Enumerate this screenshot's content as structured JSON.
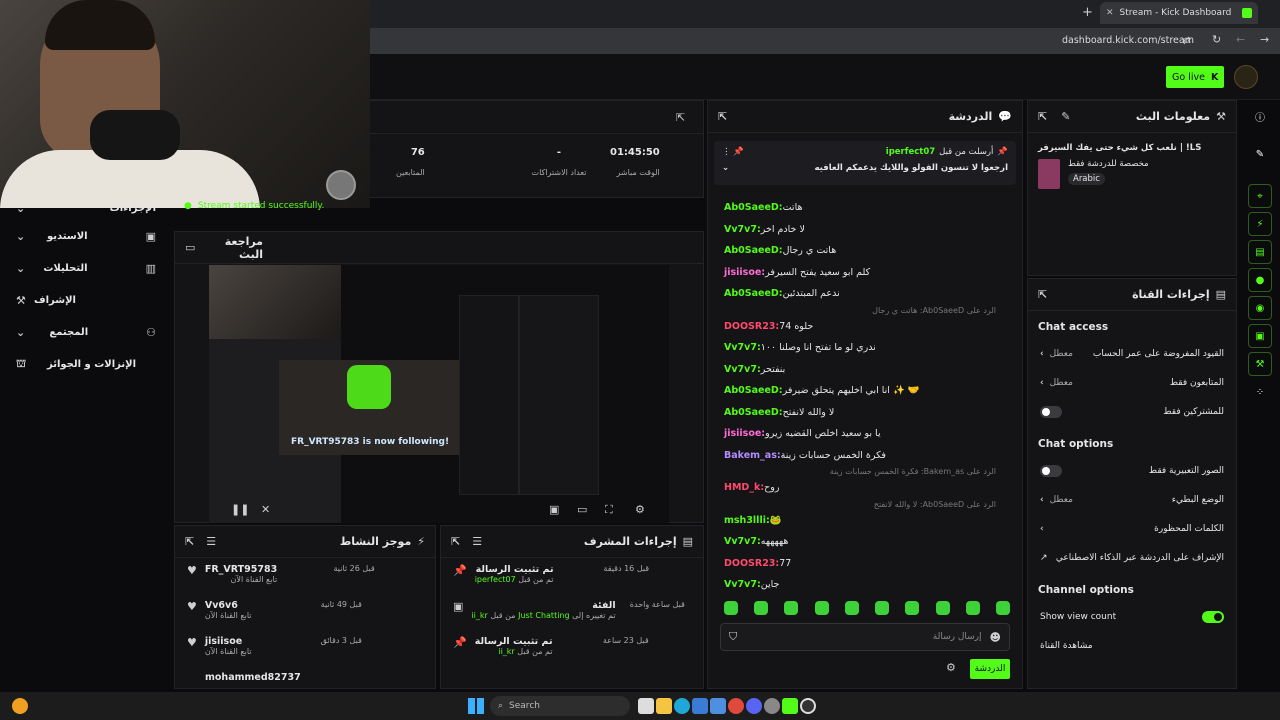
{
  "browser": {
    "tab_title": "Stream - Kick Dashboard",
    "new_tab": "+",
    "url": "dashboard.kick.com/stream"
  },
  "header": {
    "go_live_label": "Go live"
  },
  "stats": [
    {
      "value": "76",
      "label": "المتابعين"
    },
    {
      "value": "-",
      "label": "تعداد الاشتراكات"
    },
    {
      "value": "01:45:50",
      "label": "الوقت مباشر"
    }
  ],
  "toast": "Stream started successfully.",
  "preview": {
    "title": "مراجعة البث",
    "follow_text": "FR_VRT95783 is now following!"
  },
  "sidebar": {
    "items": [
      {
        "label": "الإجراءات"
      },
      {
        "label": "الاستديو"
      },
      {
        "label": "التحليلات"
      },
      {
        "label": "الإشراف"
      },
      {
        "label": "المجتمع"
      },
      {
        "label": "الإنزالات و الجوائز"
      }
    ]
  },
  "activity": {
    "title": "موجز النشاط",
    "items": [
      {
        "user": "FR_VRT95783",
        "sub": "تابع القناة الآن",
        "time": "قبل 26 ثانية"
      },
      {
        "user": "Vv6v6",
        "sub": "تابع القناة الآن",
        "time": "قبل 49 ثانية"
      },
      {
        "user": "jisiisoe",
        "sub": "تابع القناة الآن",
        "time": "قبل 3 دقائق"
      },
      {
        "user": "mohammed82737",
        "sub": "",
        "time": ""
      }
    ]
  },
  "modactions": {
    "title": "إجراءات المشرف",
    "items": [
      {
        "title": "تم تثبيت الرسالة",
        "sub_prefix": "تم من قبل",
        "sub_user": "iperfect07",
        "time": "قبل 16 دقيقة"
      },
      {
        "title": "الفئة",
        "sub_prefix": "تم تغييره إلى",
        "sub_user": "Just Chatting",
        "sub_by": "من قبل",
        "sub_user2": "ii_kr",
        "time": "قبل ساعة واحدة"
      },
      {
        "title": "تم تثبيت الرسالة",
        "sub_prefix": "تم من قبل",
        "sub_user": "ii_kr",
        "time": "قبل 23 ساعة"
      }
    ]
  },
  "chat": {
    "title": "الدردشة",
    "pinned_by": "أرسلت من قبل",
    "pinned_user": "iperfect07",
    "pinned_text": "ارجعوا لا تنسون الفولو واللايك يدعمكم العافيه",
    "messages": [
      {
        "user": "Ab0SaeeD:",
        "text": "هاتت",
        "color": "#53fc18"
      },
      {
        "user": "Vv7v7:",
        "text": "لا خادم اخر",
        "color": "#53fc18"
      },
      {
        "user": "Ab0SaeeD:",
        "text": "هاتت ي رجال",
        "color": "#53fc18"
      },
      {
        "user": "jisiisoe:",
        "text": "كلم ابو سعيد يفتح السيرفر",
        "color": "#ff6bd5"
      },
      {
        "user": "Ab0SaeeD:",
        "text": "ندعم المبتدئين",
        "color": "#53fc18"
      },
      {
        "user": "DOOSR23:",
        "text": "حلوه 74",
        "color": "#ff4a6b",
        "reply": "الرد على Ab0SaeeD: هاتت ي رجال"
      },
      {
        "user": "Vv7v7:",
        "text": "ندري لو ما تفتح انا وصلنا ١٠٠",
        "color": "#53fc18"
      },
      {
        "user": "Vv7v7:",
        "text": "بنفتحر",
        "color": "#53fc18"
      },
      {
        "user": "Ab0SaeeD:",
        "text": "انا ابي اخليهم يتحلق ضيرفر ✨ 🤝",
        "color": "#53fc18"
      },
      {
        "user": "Ab0SaeeD:",
        "text": "لا والله لانفتح",
        "color": "#53fc18"
      },
      {
        "user": "jisiisoe:",
        "text": "يا بو سعيد اخلص القضيه زيرو",
        "color": "#ff6bd5"
      },
      {
        "user": "Bakem_as:",
        "text": "فكرة الخمس حسابات زينة",
        "color": "#b48cff"
      },
      {
        "user": "HMD_k:",
        "text": "روح",
        "color": "#ff4a6b",
        "reply": "الرد على Bakem_as: فكرة الخمس حسابات زينة"
      },
      {
        "user": "msh3llli:",
        "text": "🐸",
        "color": "#53fc18",
        "reply": "الرد على Ab0SaeeD: لا والله لانفتح"
      },
      {
        "user": "Vv7v7:",
        "text": "هههههه",
        "color": "#53fc18"
      },
      {
        "user": "DOOSR23:",
        "text": "77",
        "color": "#ff4a6b"
      },
      {
        "user": "Vv7v7:",
        "text": "جاين",
        "color": "#53fc18"
      }
    ],
    "input_placeholder": "إرسال رسالة",
    "send_label": "الدردشة"
  },
  "streaminfo": {
    "title": "معلومات البث",
    "stream_title": "LS! | نلعب كل شيء حتى يفك السيرفر",
    "category": "مخصصة للدردشة فقط",
    "language": "Arabic"
  },
  "channel": {
    "title": "إجراءات القناة",
    "chat_access": "Chat access",
    "access_rows": [
      {
        "label": "القيود المفروضة على عمر الحساب",
        "value": "معطل",
        "kind": "arrow"
      },
      {
        "label": "المتابعون فقط",
        "value": "معطل",
        "kind": "arrow"
      },
      {
        "label": "للمشتركين فقط",
        "value": "",
        "kind": "toggle-off"
      }
    ],
    "chat_options": "Chat options",
    "option_rows": [
      {
        "label": "الصور التعبيرية فقط",
        "value": "",
        "kind": "toggle-off"
      },
      {
        "label": "الوضع البطيء",
        "value": "معطل",
        "kind": "arrow"
      },
      {
        "label": "الكلمات المحظورة",
        "value": "",
        "kind": "arrow"
      },
      {
        "label": "الإشراف على الدردشة عبر الذكاء الاصطناعي",
        "value": "",
        "kind": "external"
      }
    ],
    "channel_options": "Channel options",
    "show_view_count": "Show view count",
    "share_channel": "مشاهدة القناة"
  },
  "taskbar": {
    "search_placeholder": "Search"
  },
  "colors": {
    "accent": "#53fc18",
    "bg": "#0b0b0d",
    "panel": "#141417"
  }
}
